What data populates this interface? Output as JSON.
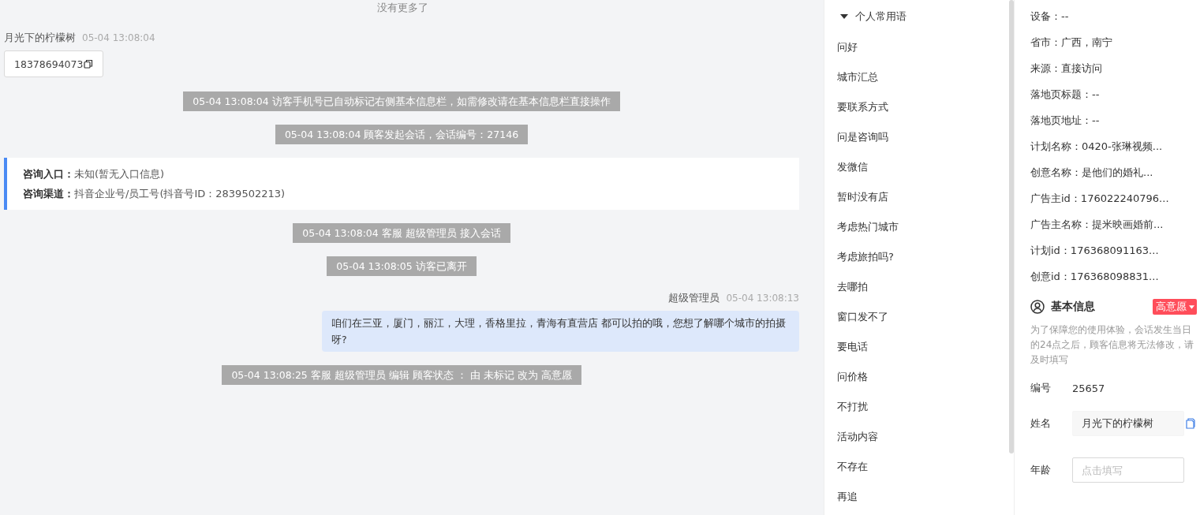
{
  "chat": {
    "no_more": "没有更多了",
    "messages": [
      {
        "kind": "visitor",
        "sender": "月光下的柠檬树",
        "time": "05-04 13:08:04",
        "phone": "18378694073"
      },
      {
        "kind": "event",
        "text": "05-04 13:08:04 访客手机号已自动标记右侧基本信息栏，如需修改请在基本信息栏直接操作"
      },
      {
        "kind": "event",
        "text": "05-04 13:08:04 顾客发起会话，会话编号：27146"
      },
      {
        "kind": "info",
        "rows": [
          "**咨询入口：**未知(暂无入口信息)",
          "**咨询渠道：**抖音企业号/员工号(抖音号ID：2839502213)"
        ]
      },
      {
        "kind": "event",
        "text": "05-04 13:08:04 客服 超级管理员 接入会话"
      },
      {
        "kind": "event",
        "text": "05-04 13:08:05 访客已离开"
      },
      {
        "kind": "agent",
        "sender": "超级管理员",
        "time": "05-04 13:08:13",
        "text": "咱们在三亚，厦门，丽江，大理，香格里拉，青海有直营店 都可以拍的哦，您想了解哪个城市的拍摄呀?"
      },
      {
        "kind": "event",
        "text": "05-04 13:08:25 客服 超级管理员 编辑 顾客状态 ： 由 未标记 改为 高意愿"
      }
    ]
  },
  "phrases": {
    "title": "个人常用语",
    "expanded": true,
    "items": [
      "问好",
      "城市汇总",
      "要联系方式",
      "问是咨询吗",
      "发微信",
      "暂时没有店",
      "考虑热门城市",
      "考虑旅拍吗?",
      "去哪拍",
      "窗口发不了",
      "要电话",
      "问价格",
      "不打扰",
      "活动内容",
      "不存在",
      "再追"
    ]
  },
  "visitor_info": [
    "设备：--",
    "省市：广西，南宁",
    "来源：直接访问",
    "落地页标题：--",
    "落地页地址：--",
    "计划名称：0420-张琳视频...",
    "创意名称：是他们的婚礼...",
    "广告主id：176022240796...",
    "广告主名称：提米映画婚前...",
    "计划id：176368091163...",
    "创意id：176368098831..."
  ],
  "basic_info": {
    "title": "基本信息",
    "status": {
      "label": "高意愿",
      "color": "#ff4d5a"
    },
    "notice": "为了保障您的使用体验，会话发生当日的24点之后，顾客信息将无法修改，请及时填写",
    "fields": [
      {
        "kind": "static",
        "label": "编号",
        "value": "25657"
      },
      {
        "kind": "input",
        "label": "姓名",
        "value": "月光下的柠檬树",
        "copy": true
      },
      {
        "kind": "input",
        "label": "年龄",
        "placeholder": "点击填写",
        "copy": false
      }
    ]
  }
}
